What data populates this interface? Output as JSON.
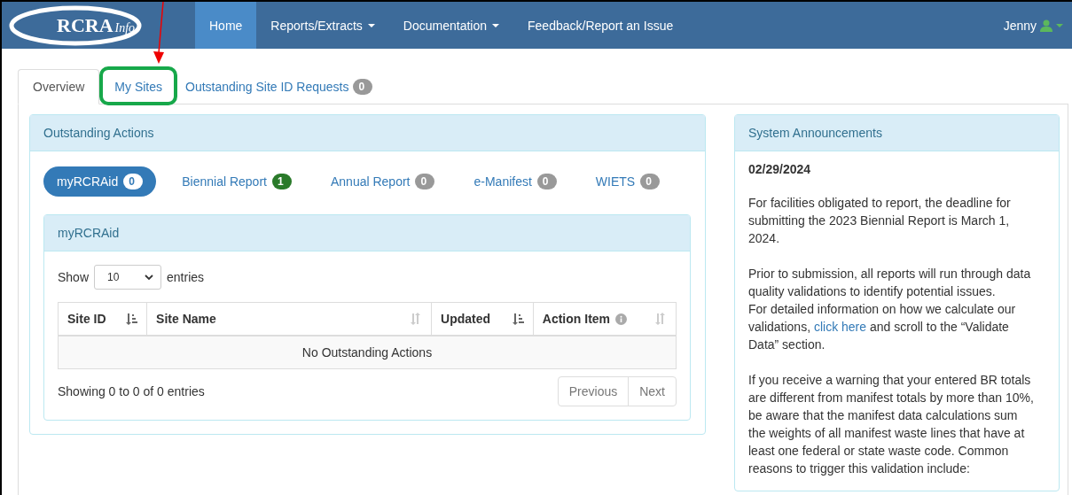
{
  "navbar": {
    "logo": "RCRA",
    "logo_suffix": "Info",
    "items": [
      {
        "label": "Home",
        "selected": true,
        "dropdown": false
      },
      {
        "label": "Reports/Extracts",
        "selected": false,
        "dropdown": true
      },
      {
        "label": "Documentation",
        "selected": false,
        "dropdown": true
      },
      {
        "label": "Feedback/Report an Issue",
        "selected": false,
        "dropdown": false
      }
    ],
    "user": "Jenny"
  },
  "tabs": [
    {
      "label": "Overview",
      "selected": true,
      "highlighted": false
    },
    {
      "label": "My Sites",
      "selected": false,
      "highlighted": true
    },
    {
      "label": "Outstanding Site ID Requests",
      "selected": false,
      "highlighted": false,
      "count": "0"
    }
  ],
  "outstanding_actions": {
    "title": "Outstanding Actions",
    "pills": [
      {
        "label": "myRCRAid",
        "count": "0",
        "selected": true,
        "color": "#ffffff"
      },
      {
        "label": "Biennial Report",
        "count": "1",
        "selected": false,
        "color": "#2a7a2a"
      },
      {
        "label": "Annual Report",
        "count": "0",
        "selected": false,
        "color": "#999999"
      },
      {
        "label": "e-Manifest",
        "count": "0",
        "selected": false,
        "color": "#999999"
      },
      {
        "label": "WIETS",
        "count": "0",
        "selected": false,
        "color": "#999999"
      }
    ],
    "subpanel": {
      "title": "myRCRAid",
      "show_label": "Show",
      "page_size": "10",
      "entries_label": "entries",
      "columns": [
        {
          "label": "Site ID",
          "sorted": true,
          "info": false
        },
        {
          "label": "Site Name",
          "sorted": false,
          "info": false
        },
        {
          "label": "Updated",
          "sorted": true,
          "info": false
        },
        {
          "label": "Action Item",
          "sorted": false,
          "info": true
        }
      ],
      "empty_message": "No Outstanding Actions",
      "summary": "Showing 0 to 0 of 0 entries",
      "pager": [
        "Previous",
        "Next"
      ]
    }
  },
  "announcements": {
    "title": "System Announcements",
    "date": "02/29/2024",
    "paragraphs": [
      [
        {
          "text": "For facilities obligated to report, the deadline for submitting the 2023 Biennial Report is March 1, 2024."
        }
      ],
      [
        {
          "text": "Prior to submission, all reports will run through data quality validations to identify potential issues."
        },
        {
          "text": "For detailed information on how we calculate our validations, ",
          "link": "click here",
          "after": " and scroll to the “Validate Data” section."
        }
      ],
      [
        {
          "text": "If you receive a warning that your entered BR totals are different from manifest totals by more than 10%, be aware that the manifest data calculations sum the weights of all manifest waste lines that have at least one federal or state waste code. Common reasons to trigger this validation include:"
        }
      ]
    ]
  }
}
